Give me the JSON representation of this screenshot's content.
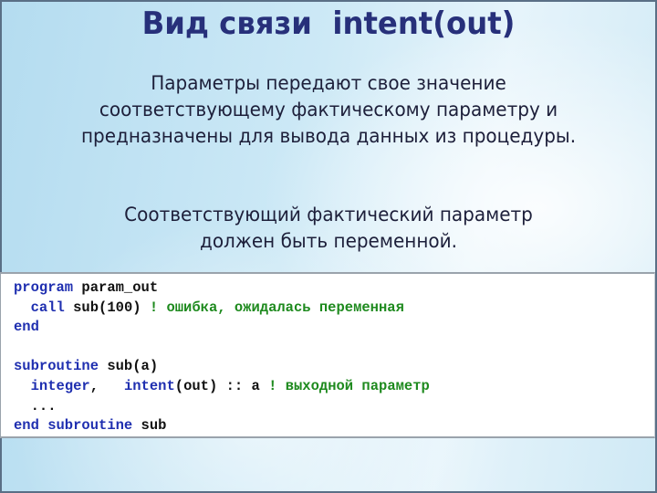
{
  "slide": {
    "title": "Вид связи  intent(out)",
    "paragraph1": [
      "Параметры передают свое значение",
      "соответствующему фактическому параметру и",
      "предназначены для вывода данных из процедуры."
    ],
    "paragraph2": [
      "Соответствующий фактический параметр",
      "должен быть переменной."
    ]
  },
  "colors": {
    "title": "#27307a",
    "body_text": "#1d1f3a",
    "code_keyword": "#1f2fb0",
    "code_comment": "#1e8a1e",
    "code_text": "#111111",
    "frame_border": "#5a6f86"
  },
  "code": {
    "lines": [
      [
        {
          "t": "kw",
          "s": "program"
        },
        {
          "t": "tx",
          "s": " param_out"
        }
      ],
      [
        {
          "t": "tx",
          "s": "  "
        },
        {
          "t": "kw",
          "s": "call"
        },
        {
          "t": "tx",
          "s": " sub(100) "
        },
        {
          "t": "cm",
          "s": "! ошибка, ожидалась переменная"
        }
      ],
      [
        {
          "t": "kw",
          "s": "end"
        }
      ],
      [],
      [
        {
          "t": "kw",
          "s": "subroutine"
        },
        {
          "t": "tx",
          "s": " sub(a)"
        }
      ],
      [
        {
          "t": "tx",
          "s": "  "
        },
        {
          "t": "kw",
          "s": "integer"
        },
        {
          "t": "tx",
          "s": ",   "
        },
        {
          "t": "kw",
          "s": "intent"
        },
        {
          "t": "tx",
          "s": "(out) :: a "
        },
        {
          "t": "cm",
          "s": "! выходной параметр"
        }
      ],
      [
        {
          "t": "tx",
          "s": "  ..."
        }
      ],
      [
        {
          "t": "kw",
          "s": "end subroutine"
        },
        {
          "t": "tx",
          "s": " sub"
        }
      ]
    ]
  }
}
